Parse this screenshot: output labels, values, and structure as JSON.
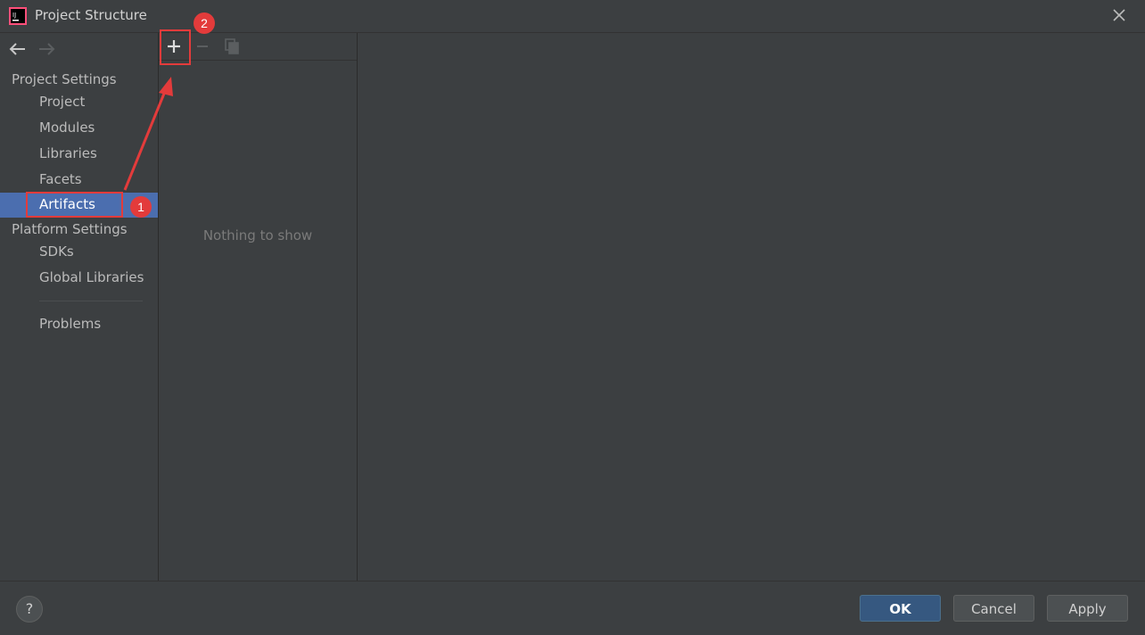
{
  "window": {
    "title": "Project Structure"
  },
  "sidebar": {
    "project_settings_header": "Project Settings",
    "project_items": [
      {
        "label": "Project"
      },
      {
        "label": "Modules"
      },
      {
        "label": "Libraries"
      },
      {
        "label": "Facets"
      },
      {
        "label": "Artifacts"
      }
    ],
    "platform_settings_header": "Platform Settings",
    "platform_items": [
      {
        "label": "SDKs"
      },
      {
        "label": "Global Libraries"
      }
    ],
    "problems_label": "Problems",
    "selected": "Artifacts"
  },
  "middle": {
    "empty_text": "Nothing to show"
  },
  "toolbar": {
    "add_icon": "plus-icon",
    "remove_icon": "minus-icon",
    "copy_icon": "copy-icon"
  },
  "footer": {
    "help_label": "?",
    "ok_label": "OK",
    "cancel_label": "Cancel",
    "apply_label": "Apply"
  },
  "annotations": {
    "badge_1": "1",
    "badge_2": "2",
    "color": "#e33b3b"
  },
  "colors": {
    "background": "#3c3f41",
    "selection": "#4b6eaf",
    "ok_button": "#365880"
  }
}
